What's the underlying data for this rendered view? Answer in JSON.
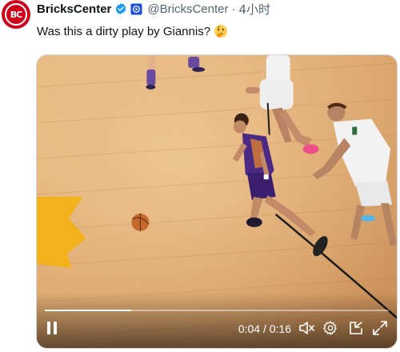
{
  "tweet": {
    "avatar_text": "BC",
    "display_name": "BricksCenter",
    "handle": "@BricksCenter",
    "separator": "·",
    "time": "4小时",
    "text": "Was this a dirty play by Giannis?",
    "emoji_icon": "thinking-face-icon"
  },
  "video": {
    "current_time": "0:04",
    "duration": "0:16",
    "time_display": "0:04 / 0:16",
    "progress_fraction": 0.25,
    "state": "playing",
    "controls": [
      "pause-icon",
      "mute-icon",
      "settings-gear-icon",
      "picture-in-picture-icon",
      "fullscreen-icon"
    ]
  },
  "colors": {
    "verified_blue": "#1d9bf0",
    "avatar_red": "#d0021b",
    "suns_purple": "#4b2a86",
    "court_wood": "#d9a36b"
  }
}
